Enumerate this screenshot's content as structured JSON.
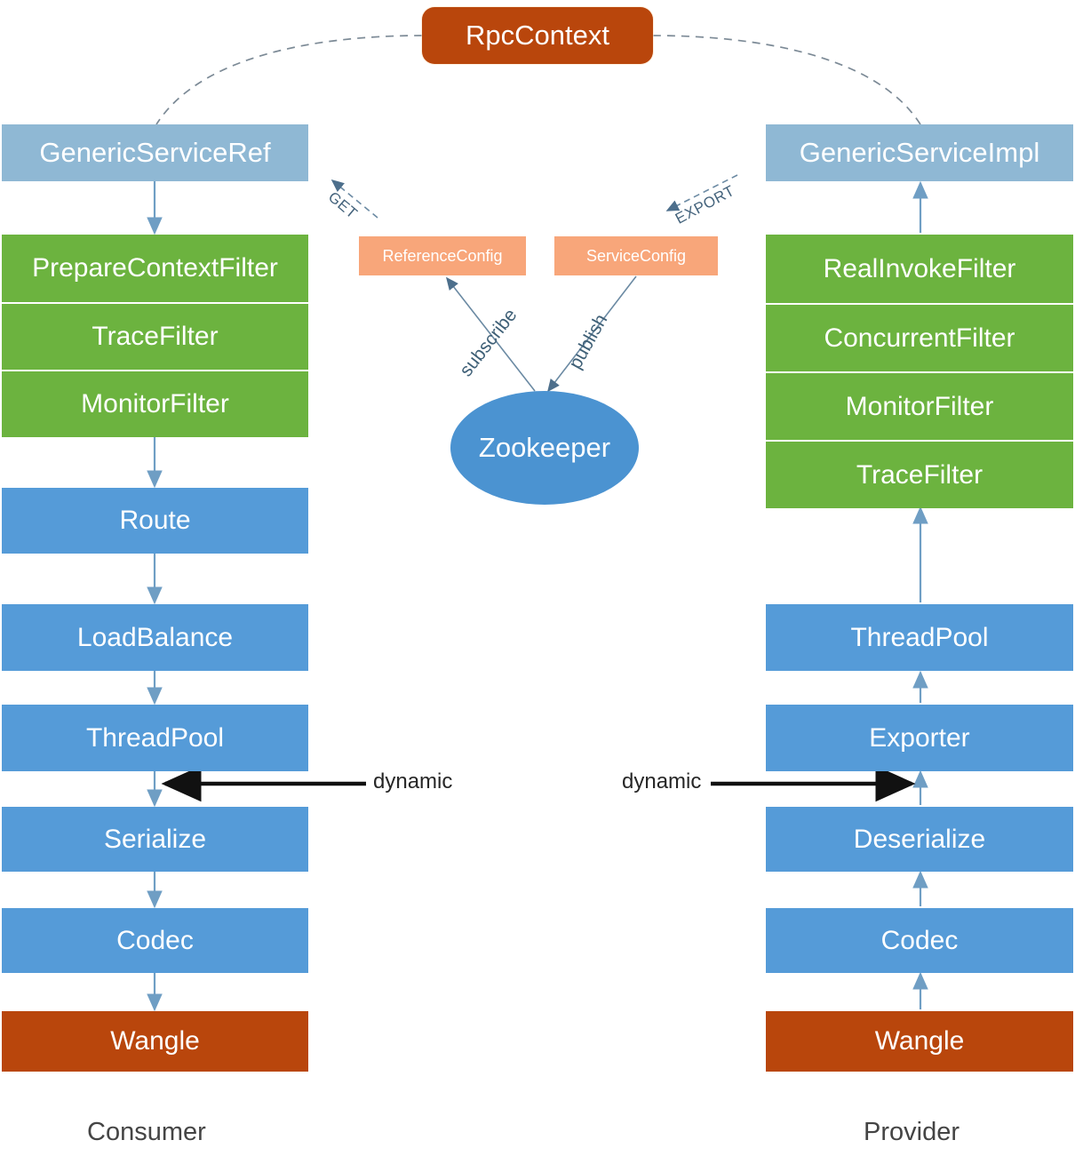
{
  "diagram": {
    "title_node": {
      "label": "RpcContext"
    },
    "registry": {
      "label": "Zookeeper"
    },
    "configs": [
      {
        "label": "ReferenceConfig"
      },
      {
        "label": "ServiceConfig"
      }
    ],
    "columns": [
      {
        "name": "consumer",
        "caption": "Consumer",
        "entry": {
          "label": "GenericServiceRef"
        },
        "filters": [
          {
            "label": "PrepareContextFilter"
          },
          {
            "label": "TraceFilter"
          },
          {
            "label": "MonitorFilter"
          }
        ],
        "stages": [
          {
            "label": "Route"
          },
          {
            "label": "LoadBalance"
          },
          {
            "label": "ThreadPool"
          },
          {
            "label": "Serialize"
          },
          {
            "label": "Codec"
          }
        ],
        "transport": {
          "label": "Wangle"
        }
      },
      {
        "name": "provider",
        "caption": "Provider",
        "entry": {
          "label": "GenericServiceImpl"
        },
        "filters": [
          {
            "label": "RealInvokeFilter"
          },
          {
            "label": "ConcurrentFilter"
          },
          {
            "label": "MonitorFilter"
          },
          {
            "label": "TraceFilter"
          }
        ],
        "stages": [
          {
            "label": "ThreadPool"
          },
          {
            "label": "Exporter"
          },
          {
            "label": "Deserialize"
          },
          {
            "label": "Codec"
          }
        ],
        "transport": {
          "label": "Wangle"
        }
      }
    ],
    "edge_labels": {
      "get": "GET",
      "export": "EXPORT",
      "subscribe": "subscribe",
      "publish": "publish",
      "dynamic_left": "dynamic",
      "dynamic_right": "dynamic"
    },
    "colors": {
      "entry_blue": "#8fb8d4",
      "filter_green": "#6cb33f",
      "stage_blue": "#559bd8",
      "transport_rust": "#b9460c",
      "config_salmon": "#f8a67a",
      "registry_blue": "#4b93d1",
      "arrow_blue": "#6f9ec4",
      "arrow_black": "#111111",
      "dash_gray": "#7c8a96"
    }
  }
}
